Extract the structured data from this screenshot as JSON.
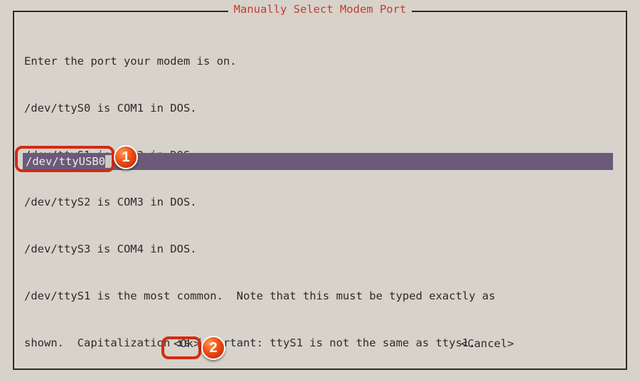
{
  "title": "Manually Select Modem Port",
  "body_lines": [
    "Enter the port your modem is on.",
    "/dev/ttyS0 is COM1 in DOS.",
    "/dev/ttyS1 is COM2 in DOS.",
    "/dev/ttyS2 is COM3 in DOS.",
    "/dev/ttyS3 is COM4 in DOS.",
    "/dev/ttyS1 is the most common.  Note that this must be typed exactly as",
    "shown.  Capitalization is important: ttyS1 is not the same as ttys1."
  ],
  "input": {
    "value": "/dev/ttyUSB0"
  },
  "buttons": {
    "ok": "<Ok>",
    "cancel": "<Cancel>"
  },
  "annotations": {
    "badge1": "1",
    "badge2": "2"
  }
}
